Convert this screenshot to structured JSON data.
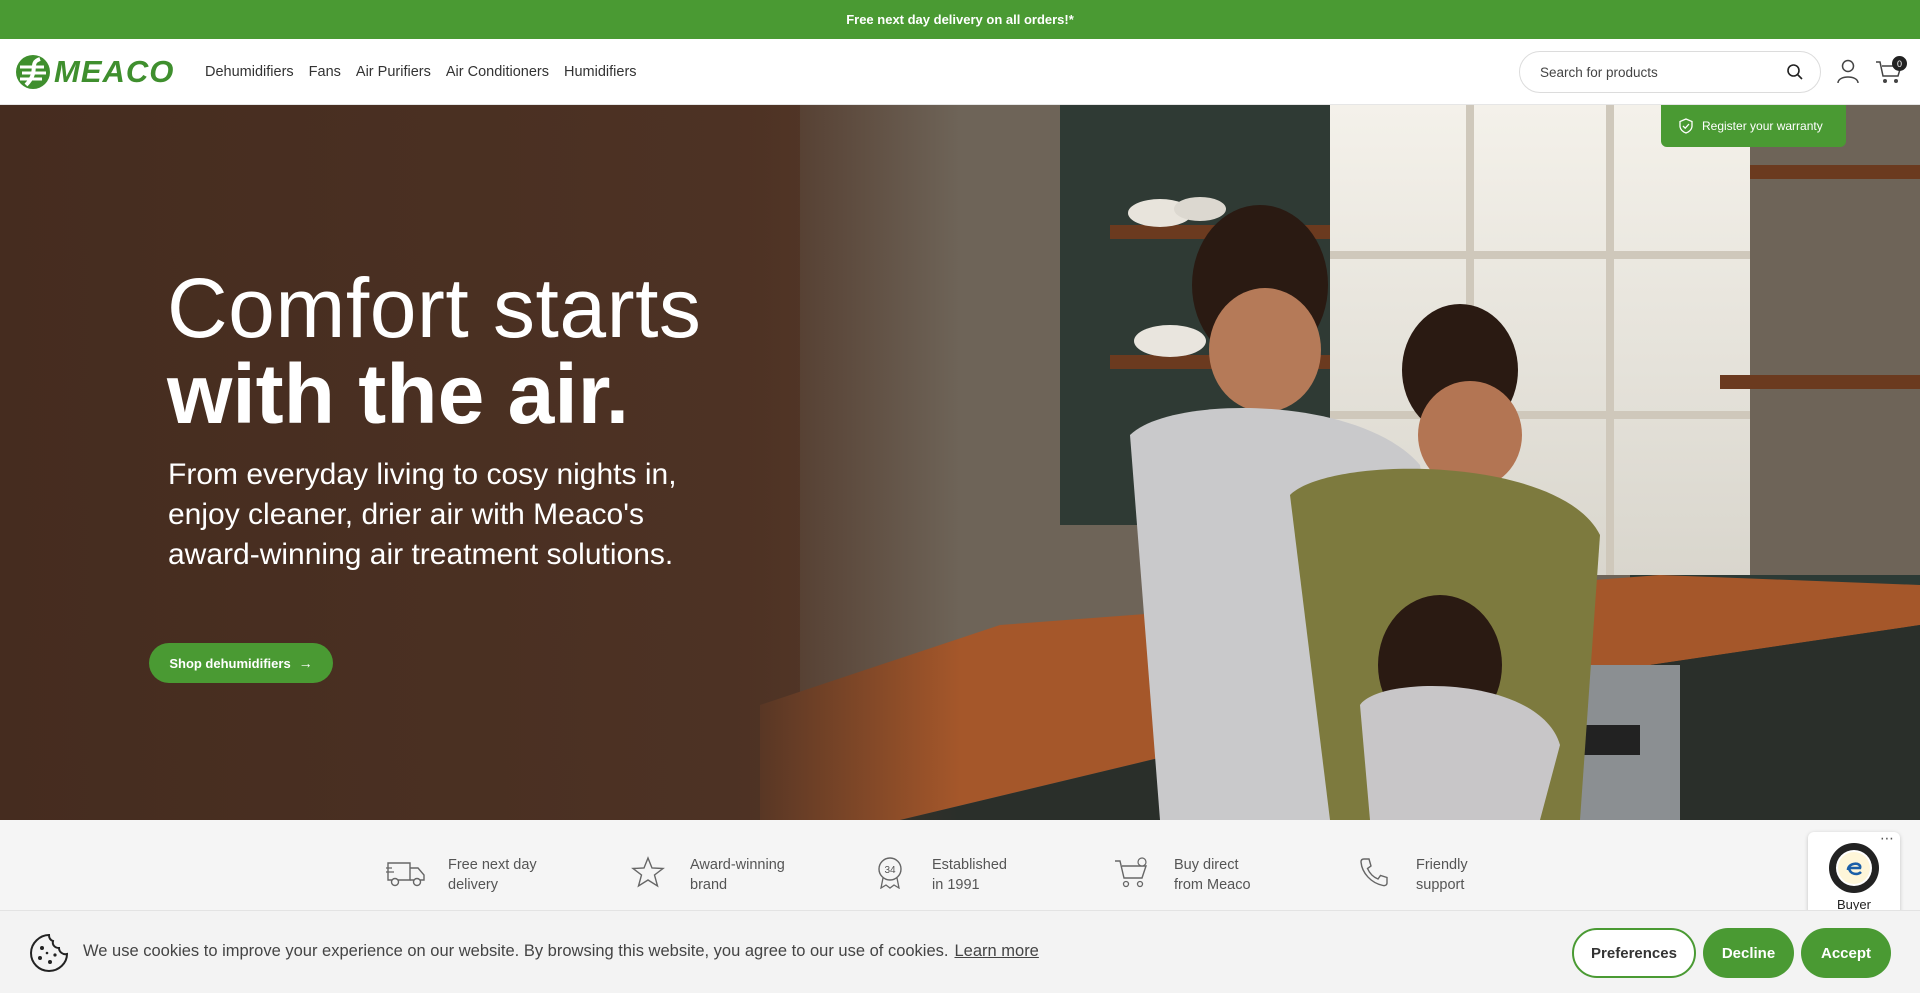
{
  "announcement": {
    "text": "Free next day delivery on all orders!*"
  },
  "header": {
    "logo_text": "MEACO",
    "nav": [
      {
        "label": "Dehumidifiers"
      },
      {
        "label": "Fans"
      },
      {
        "label": "Air Purifiers"
      },
      {
        "label": "Air Conditioners"
      },
      {
        "label": "Humidifiers"
      }
    ],
    "search": {
      "placeholder": "Search for products",
      "value": ""
    },
    "cart_count": "0"
  },
  "hero": {
    "title_line1": "Comfort starts",
    "title_line2": "with the air.",
    "subtitle": "From everyday living to cosy nights in, enjoy cleaner, drier air with Meaco's award-winning air treatment solutions.",
    "cta_label": "Shop dehumidifiers",
    "warranty_label": "Register your warranty"
  },
  "usp": [
    {
      "line1": "Free next day",
      "line2": "delivery",
      "icon": "truck-icon"
    },
    {
      "line1": "Award-winning",
      "line2": "brand",
      "icon": "star-icon"
    },
    {
      "line1": "Established",
      "line2": "in 1991",
      "icon": "anniversary-badge-icon"
    },
    {
      "line1": "Buy direct",
      "line2": "from Meaco",
      "icon": "cart-icon"
    },
    {
      "line1": "Friendly",
      "line2": "support",
      "icon": "phone-icon"
    }
  ],
  "usp_badge_number": "34",
  "trusted": {
    "label": "Buyer"
  },
  "cookie": {
    "text": "We use cookies to improve your experience on our website. By browsing this website, you agree to our use of cookies.",
    "link": "Learn more",
    "preferences": "Preferences",
    "decline": "Decline",
    "accept": "Accept"
  },
  "colors": {
    "brand_green": "#4a9a33",
    "dark_text": "#333333"
  }
}
